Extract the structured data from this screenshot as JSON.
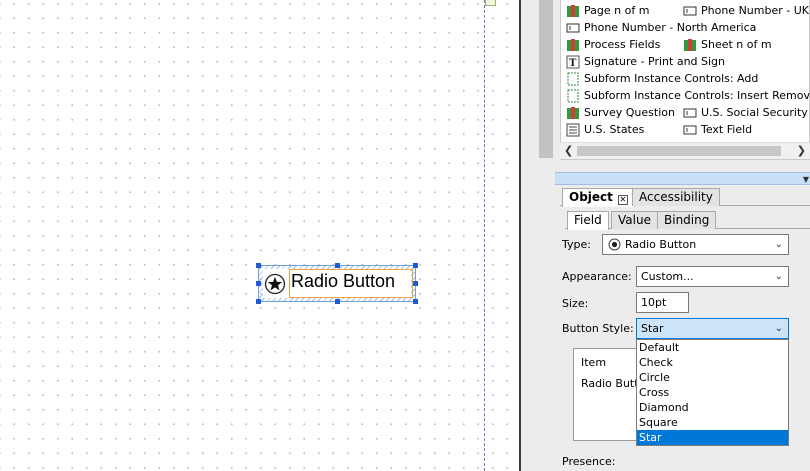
{
  "canvas": {
    "radio_field": {
      "caption": "Radio Button"
    }
  },
  "library": {
    "items": [
      {
        "label": "Page n of m",
        "icon": "book-stack-icon"
      },
      {
        "label": "Phone Number - UK",
        "icon": "text-field-icon"
      },
      {
        "label": "Phone Number - North America",
        "icon": "text-field-icon"
      },
      {
        "label": "Process Fields",
        "icon": "book-stack-icon"
      },
      {
        "label": "Sheet n of m",
        "icon": "book-stack-icon"
      },
      {
        "label": "Signature - Print and Sign",
        "icon": "text-tool-icon"
      },
      {
        "label": "Subform Instance Controls: Add",
        "icon": "subform-icon"
      },
      {
        "label": "Subform Instance Controls: Insert Remove M",
        "icon": "subform-icon"
      },
      {
        "label": "Survey Question",
        "icon": "book-stack-icon"
      },
      {
        "label": "U.S. Social Security Nu",
        "icon": "text-field-icon"
      },
      {
        "label": "U.S. States",
        "icon": "list-icon"
      },
      {
        "label": "Text Field",
        "icon": "text-field-icon"
      }
    ]
  },
  "panel": {
    "tabs": [
      {
        "label": "Object",
        "active": true
      },
      {
        "label": "Accessibility",
        "active": false
      }
    ],
    "subtabs": [
      {
        "label": "Field",
        "active": true
      },
      {
        "label": "Value",
        "active": false
      },
      {
        "label": "Binding",
        "active": false
      }
    ],
    "type_label": "Type:",
    "type_value": "Radio Button",
    "appearance_label": "Appearance:",
    "appearance_value": "Custom...",
    "size_label": "Size:",
    "size_value": "10pt",
    "button_style_label": "Button Style:",
    "button_style_value": "Star",
    "items_header": "Item",
    "items_row": "Radio Butt",
    "presence_label": "Presence:"
  },
  "dropdown": {
    "options": [
      "Default",
      "Check",
      "Circle",
      "Cross",
      "Diamond",
      "Square",
      "Star"
    ],
    "selected": "Star"
  },
  "colors": {
    "selection_blue": "#0078d7",
    "handle_blue": "#1f5ad6",
    "caption_border": "#f0a13c"
  }
}
